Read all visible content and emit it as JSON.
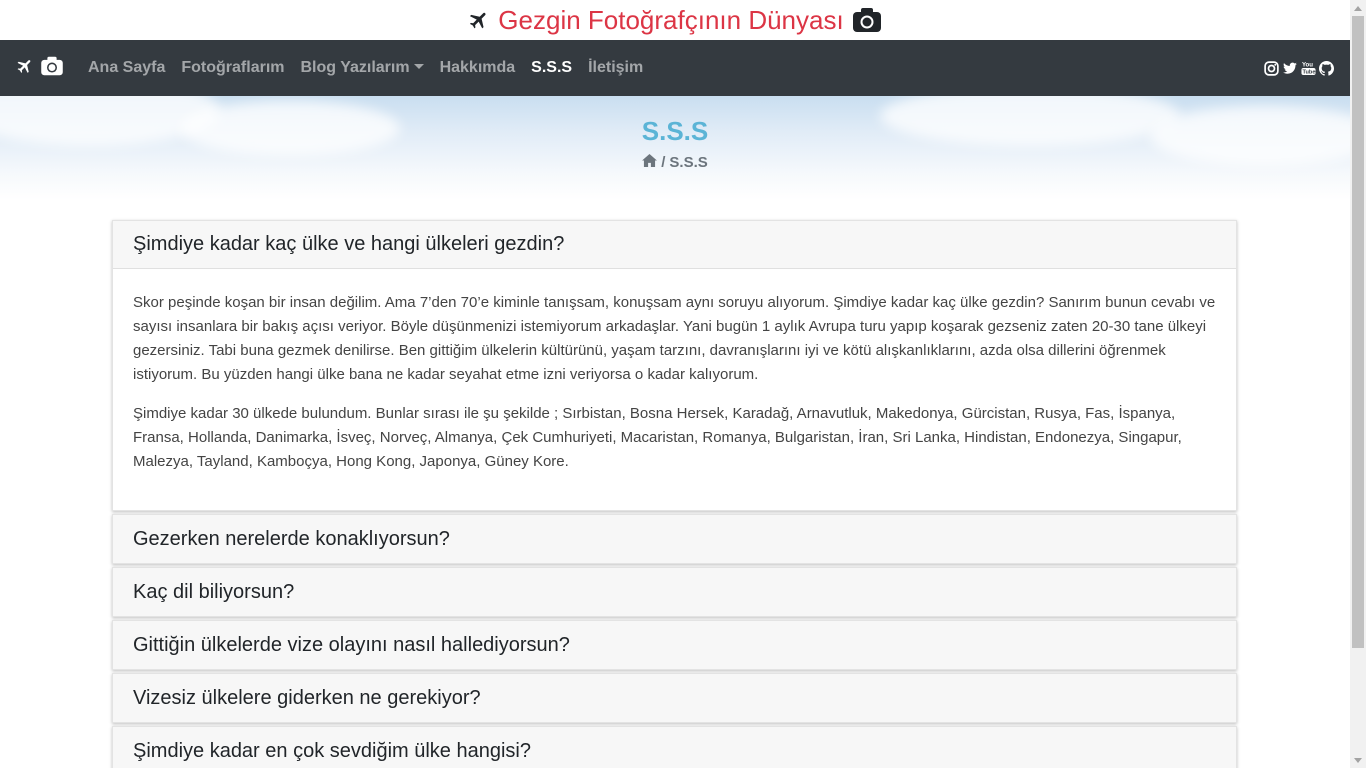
{
  "brand": {
    "title": "Gezgin Fotoğrafçının Dünyası",
    "left_icon": "plane-icon",
    "right_icon": "camera-icon"
  },
  "navbar": {
    "brand_icons": [
      "plane-icon",
      "camera-icon"
    ],
    "links": [
      {
        "label": "Ana Sayfa",
        "active": false
      },
      {
        "label": "Fotoğraflarım",
        "active": false
      },
      {
        "label": "Blog Yazılarım",
        "active": false,
        "dropdown": true
      },
      {
        "label": "Hakkımda",
        "active": false
      },
      {
        "label": "S.S.S",
        "active": true
      },
      {
        "label": "İletişim",
        "active": false
      }
    ],
    "social_icons": [
      "instagram-icon",
      "twitter-icon",
      "youtube-icon",
      "github-icon"
    ]
  },
  "hero": {
    "title": "S.S.S",
    "breadcrumb_separator": "/",
    "breadcrumb_current": "S.S.S"
  },
  "faq": [
    {
      "question": "Şimdiye kadar kaç ülke ve hangi ülkeleri gezdin?",
      "open": true,
      "paragraphs": [
        "Skor peşinde koşan bir insan değilim. Ama 7’den 70’e kiminle tanışsam, konuşsam aynı soruyu alıyorum. Şimdiye kadar kaç ülke gezdin? Sanırım bunun cevabı ve sayısı insanlara bir bakış açısı veriyor. Böyle düşünmenizi istemiyorum arkadaşlar. Yani bugün 1 aylık Avrupa turu yapıp koşarak gezseniz zaten 20-30 tane ülkeyi gezersiniz. Tabi buna gezmek denilirse. Ben gittiğim ülkelerin kültürünü, yaşam tarzını, davranışlarını iyi ve kötü alışkanlıklarını, azda olsa dillerini öğrenmek istiyorum. Bu yüzden hangi ülke bana ne kadar seyahat etme izni veriyorsa o kadar kalıyorum.",
        "Şimdiye kadar 30 ülkede bulundum. Bunlar sırası ile şu şekilde ; Sırbistan, Bosna Hersek, Karadağ, Arnavutluk, Makedonya, Gürcistan, Rusya, Fas, İspanya, Fransa, Hollanda, Danimarka, İsveç, Norveç, Almanya, Çek Cumhuriyeti, Macaristan, Romanya, Bulgaristan, İran, Sri Lanka, Hindistan, Endonezya, Singapur, Malezya, Tayland, Kamboçya, Hong Kong, Japonya, Güney Kore."
      ]
    },
    {
      "question": "Gezerken nerelerde konaklıyorsun?",
      "open": false
    },
    {
      "question": "Kaç dil biliyorsun?",
      "open": false
    },
    {
      "question": "Gittiğin ülkelerde vize olayını nasıl hallediyorsun?",
      "open": false
    },
    {
      "question": "Vizesiz ülkelere giderken ne gerekiyor?",
      "open": false
    },
    {
      "question": "Şimdiye kadar en çok sevdiğim ülke hangisi?",
      "open": false
    }
  ],
  "colors": {
    "brand_red": "#dc3545",
    "navbar_bg": "#343a40",
    "hero_title": "#5bb4d6"
  }
}
